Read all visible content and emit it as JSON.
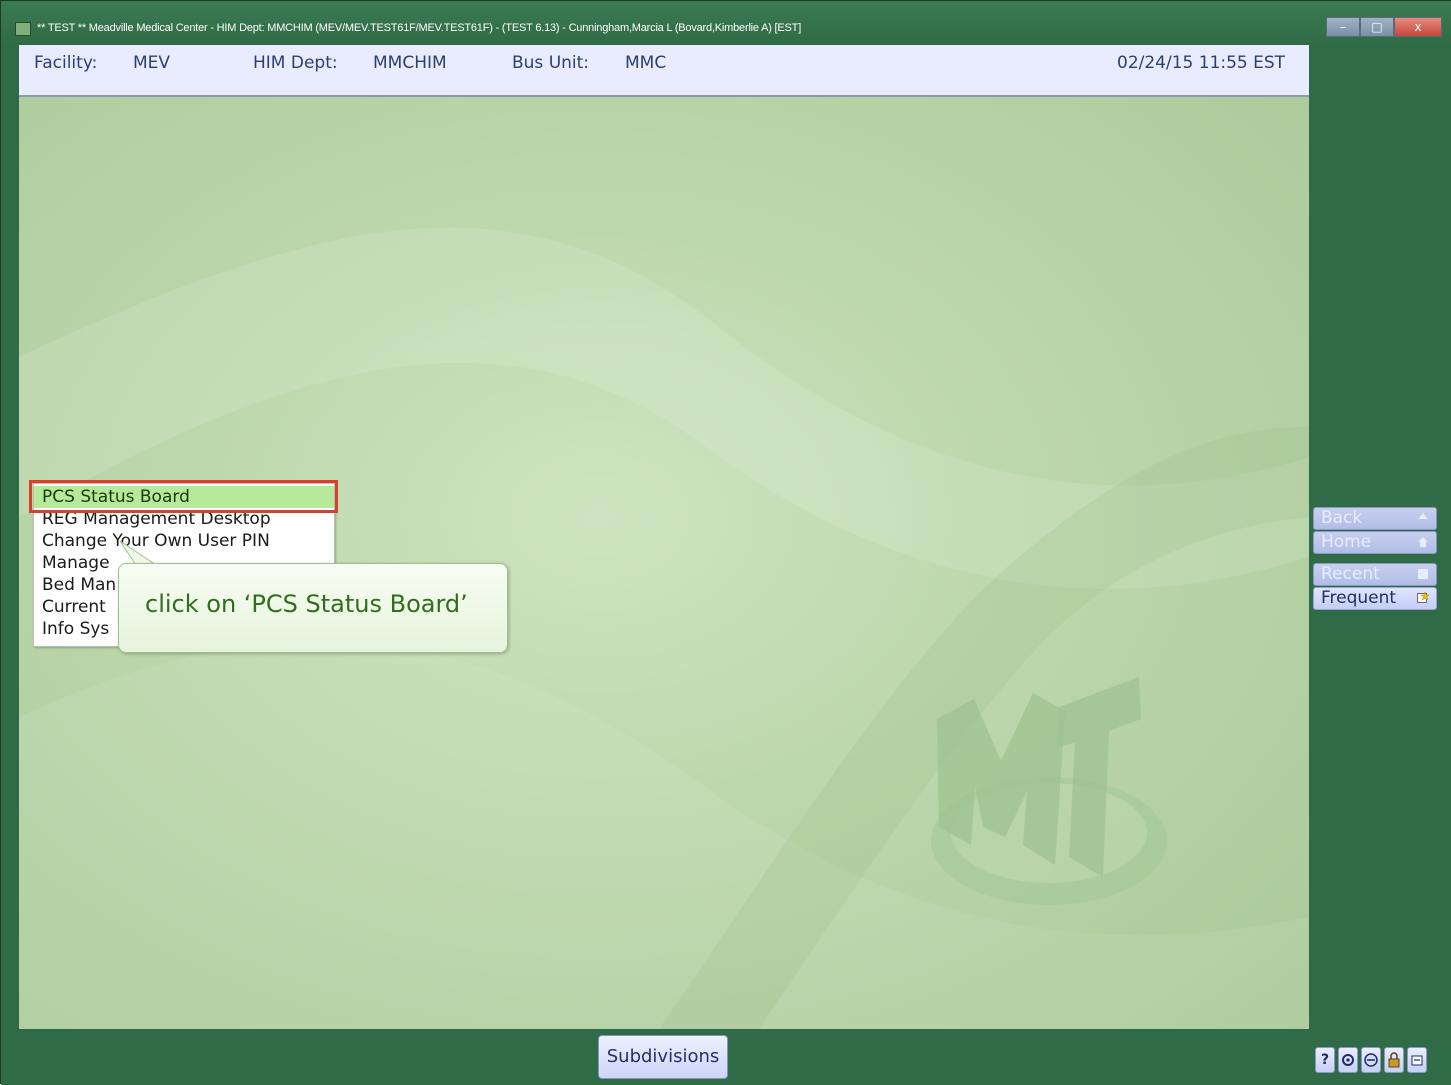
{
  "window": {
    "title": "** TEST ** Meadville Medical Center - HIM Dept: MMCHIM (MEV/MEV.TEST61F/MEV.TEST61F) - (TEST 6.13) - Cunningham,Marcia L (Bovard,Kimberlie A) [EST]",
    "buttons": {
      "minimize": "–",
      "maximize": "□",
      "close": "x"
    }
  },
  "header": {
    "facility_label": "Facility:",
    "facility_value": "MEV",
    "dept_label": "HIM Dept:",
    "dept_value": "MMCHIM",
    "bus_label": "Bus Unit:",
    "bus_value": "MMC",
    "datetime": "02/24/15 11:55 EST"
  },
  "menu": {
    "items": [
      "PCS Status Board",
      "REG Management Desktop",
      "Change Your Own User PIN",
      "Manage",
      "Bed Man",
      "Current",
      "Info Sys"
    ],
    "selected_index": 0
  },
  "callout": {
    "text": "click on ‘PCS Status Board’"
  },
  "sidebar": {
    "back": "Back",
    "home": "Home",
    "recent": "Recent",
    "frequent": "Frequent"
  },
  "footer": {
    "subdivisions": "Subdivisions",
    "tray": {
      "help": "?"
    }
  },
  "colors": {
    "accent_highlight": "#d8402c",
    "selected_item": "#b6ea9a",
    "frame_green": "#2f6b46"
  }
}
